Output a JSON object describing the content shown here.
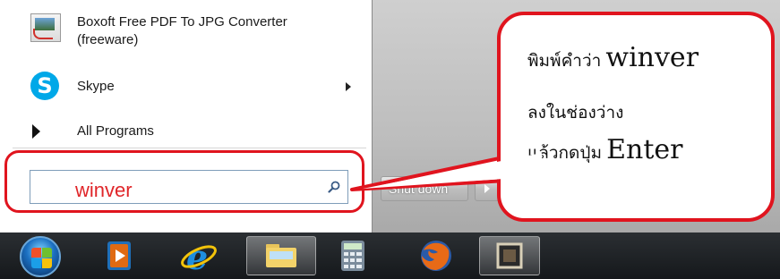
{
  "start_menu": {
    "programs": [
      {
        "label_line1": "Boxoft Free PDF To JPG Converter",
        "label_line2": "(freeware)",
        "icon": "pdf-to-jpg-icon"
      },
      {
        "label": "Skype",
        "icon": "skype-icon",
        "has_submenu": true
      }
    ],
    "all_programs_label": "All Programs",
    "search": {
      "value": "winver",
      "icon": "search-icon"
    },
    "shutdown_label": "Shut down"
  },
  "callout": {
    "line1_thai": "พิมพ์คำว่า",
    "line1_en": "winver",
    "line2_thai": "ลงในช่องว่าง",
    "line3_thai": "แล้วกดปุ่ม",
    "line3_en": "Enter"
  },
  "taskbar": {
    "items": [
      "start-orb",
      "media-player-icon",
      "internet-explorer-icon",
      "file-explorer-icon",
      "calculator-icon",
      "firefox-icon",
      "app-window-icon"
    ]
  },
  "colors": {
    "highlight": "#e0141e",
    "search_text": "#e0262a"
  }
}
